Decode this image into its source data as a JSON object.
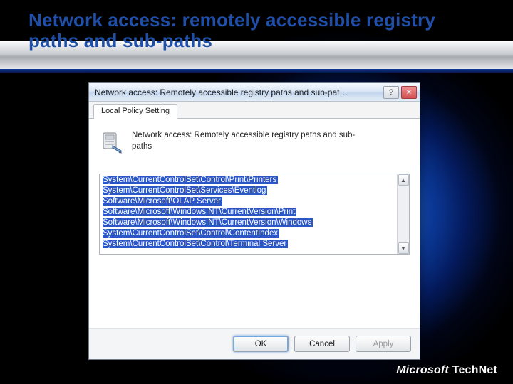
{
  "slide": {
    "title": "Network access: remotely accessible registry paths and sub-paths",
    "footer_brand": "Microsoft",
    "footer_sub": "TechNet"
  },
  "dialog": {
    "title": "Network access: Remotely accessible registry paths and sub-pat…",
    "help_glyph": "?",
    "close_glyph": "×",
    "tab_label": "Local Policy Setting",
    "heading": "Network access: Remotely accessible registry paths and sub-paths",
    "icon_name": "registry-server-icon",
    "list_items": [
      "System\\CurrentControlSet\\Control\\Print\\Printers",
      "System\\CurrentControlSet\\Services\\Eventlog",
      "Software\\Microsoft\\OLAP Server",
      "Software\\Microsoft\\Windows NT\\CurrentVersion\\Print",
      "Software\\Microsoft\\Windows NT\\CurrentVersion\\Windows",
      "System\\CurrentControlSet\\Control\\ContentIndex",
      "System\\CurrentControlSet\\Control\\Terminal Server"
    ],
    "scroll_up_glyph": "▲",
    "scroll_down_glyph": "▼",
    "buttons": {
      "ok": "OK",
      "cancel": "Cancel",
      "apply": "Apply"
    }
  }
}
